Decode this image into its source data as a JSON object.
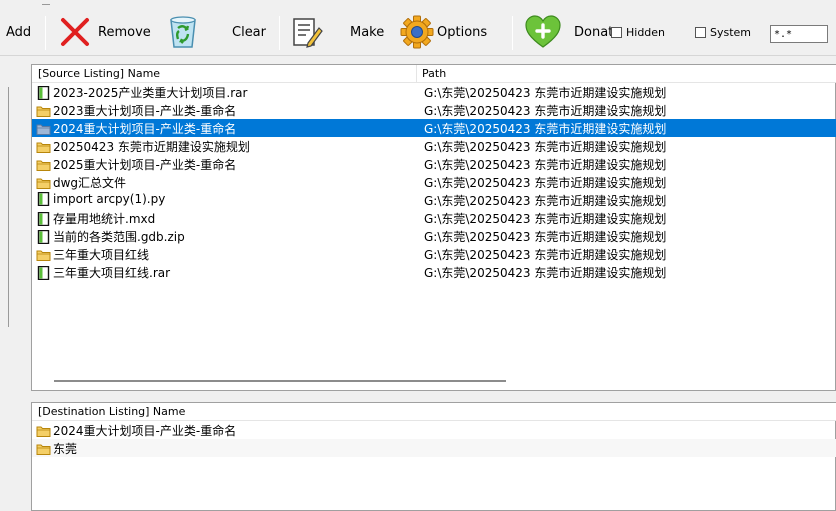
{
  "toolbar": {
    "add_label": "Add",
    "remove_label": "Remove",
    "clear_label": "Clear",
    "make_label": "Make",
    "options_label": "Options",
    "donate_label": "Donat",
    "hidden_label": "Hidden",
    "system_label": "System",
    "filter_value": "*.*"
  },
  "source": {
    "header_name": "[Source Listing] Name",
    "header_path": "Path",
    "rows": [
      {
        "icon": "file",
        "name": "2023-2025产业类重大计划项目.rar",
        "path": "G:\\东莞\\20250423 东莞市近期建设实施规划"
      },
      {
        "icon": "folder",
        "name": "2023重大计划项目-产业类-重命名",
        "path": "G:\\东莞\\20250423 东莞市近期建设实施规划"
      },
      {
        "icon": "folder",
        "name": "2024重大计划项目-产业类-重命名",
        "path": "G:\\东莞\\20250423 东莞市近期建设实施规划"
      },
      {
        "icon": "folder",
        "name": "20250423 东莞市近期建设实施规划",
        "path": "G:\\东莞\\20250423 东莞市近期建设实施规划"
      },
      {
        "icon": "folder",
        "name": "2025重大计划项目-产业类-重命名",
        "path": "G:\\东莞\\20250423 东莞市近期建设实施规划"
      },
      {
        "icon": "folder",
        "name": "dwg汇总文件",
        "path": "G:\\东莞\\20250423 东莞市近期建设实施规划"
      },
      {
        "icon": "file",
        "name": "import arcpy(1).py",
        "path": "G:\\东莞\\20250423 东莞市近期建设实施规划"
      },
      {
        "icon": "file",
        "name": "存量用地统计.mxd",
        "path": "G:\\东莞\\20250423 东莞市近期建设实施规划"
      },
      {
        "icon": "file",
        "name": "当前的各类范围.gdb.zip",
        "path": "G:\\东莞\\20250423 东莞市近期建设实施规划"
      },
      {
        "icon": "folder",
        "name": "三年重大项目红线",
        "path": "G:\\东莞\\20250423 东莞市近期建设实施规划"
      },
      {
        "icon": "file",
        "name": "三年重大项目红线.rar",
        "path": "G:\\东莞\\20250423 东莞市近期建设实施规划"
      }
    ]
  },
  "destination": {
    "header_name": "[Destination Listing] Name",
    "rows": [
      {
        "icon": "folder",
        "name": "2024重大计划项目-产业类-重命名"
      },
      {
        "icon": "folder",
        "name": "东莞"
      }
    ]
  },
  "colors": {
    "selection": "#0078d7",
    "remove_icon": "#e02020",
    "folder": "#e8b84a"
  }
}
